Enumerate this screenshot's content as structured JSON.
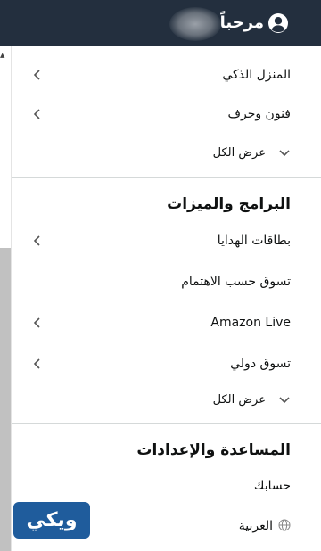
{
  "header": {
    "greeting": "مرحباً"
  },
  "menu": {
    "top_items": [
      {
        "label": "المنزل الذكي"
      },
      {
        "label": "فنون وحرف"
      }
    ],
    "see_all_1": "عرض الكل",
    "programs": {
      "title": "البرامج والميزات",
      "items": [
        {
          "label": "بطاقات الهدايا"
        },
        {
          "label": "تسوق حسب الاهتمام"
        },
        {
          "label": "Amazon Live"
        },
        {
          "label": "تسوق دولي"
        }
      ],
      "see_all": "عرض الكل"
    },
    "help": {
      "title": "المساعدة والإعدادات",
      "account": "حسابك",
      "language": "العربية"
    }
  },
  "watermark": {
    "text": "ويكي"
  }
}
